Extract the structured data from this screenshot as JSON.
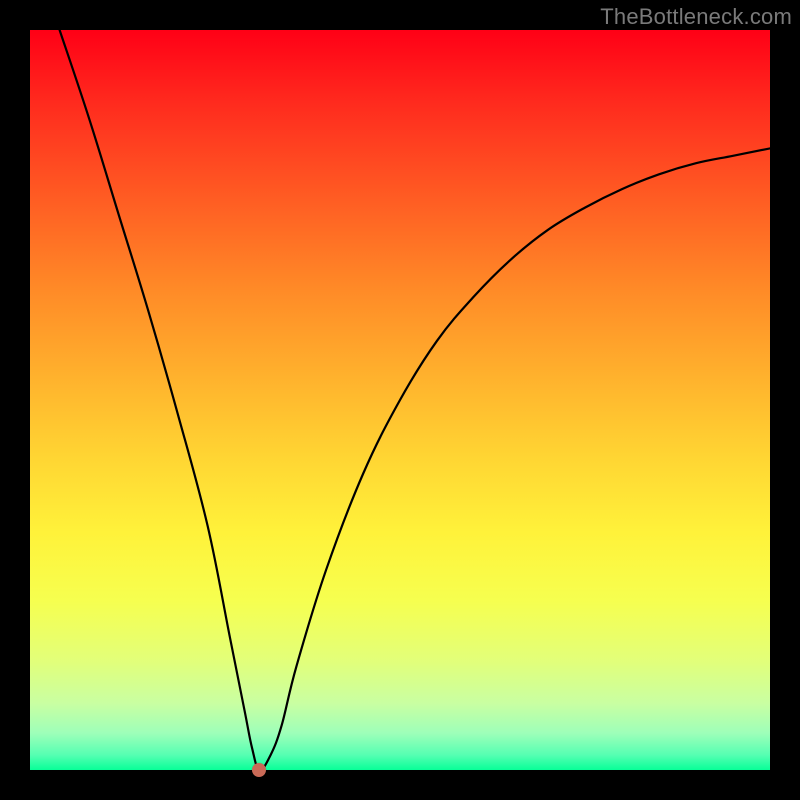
{
  "watermark": "TheBottleneck.com",
  "chart_data": {
    "type": "line",
    "title": "",
    "xlabel": "",
    "ylabel": "",
    "xlim": [
      0,
      100
    ],
    "ylim": [
      0,
      100
    ],
    "grid": false,
    "legend": false,
    "minimum_point": {
      "x": 31,
      "y": 0,
      "color": "#c96a57"
    },
    "background_gradient": {
      "top": "#ff0016",
      "upper_mid": "#ffb22d",
      "mid": "#fff23a",
      "lower_mid": "#c9ffa2",
      "bottom": "#08ff98"
    },
    "series": [
      {
        "name": "bottleneck-curve",
        "x": [
          4,
          8,
          12,
          16,
          20,
          24,
          27,
          29,
          30,
          31,
          32.5,
          34,
          36,
          40,
          45,
          50,
          55,
          60,
          65,
          70,
          75,
          80,
          85,
          90,
          95,
          100
        ],
        "values": [
          100,
          88,
          75,
          62,
          48,
          33,
          18,
          8,
          3,
          0,
          2,
          6,
          14,
          27,
          40,
          50,
          58,
          64,
          69,
          73,
          76,
          78.5,
          80.5,
          82,
          83,
          84
        ]
      }
    ]
  }
}
